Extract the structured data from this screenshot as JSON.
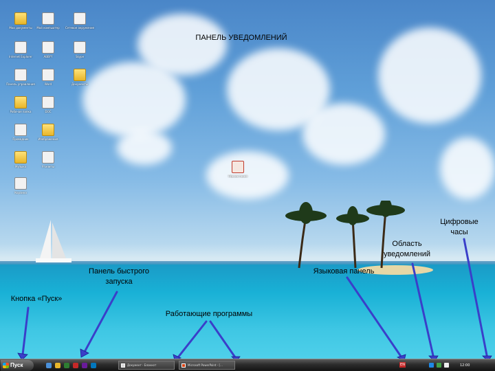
{
  "annotations": {
    "notification_panel": "ПАНЕЛЬ УВЕДОМЛЕНИЙ",
    "digital_clock": "Цифровые часы",
    "tray_area": "Область уведомлений",
    "quick_launch": "Панель быстрого запуска",
    "language_bar": "Языковая панель",
    "start_button": "Кнопка «Пуск»",
    "running_programs": "Работающие программы"
  },
  "taskbar": {
    "start_label": "Пуск",
    "tasks": [
      {
        "label": "Документ - Блокнот"
      },
      {
        "label": "Microsoft PowerPoint - [..."
      }
    ],
    "language": "EN",
    "clock": "12:00"
  },
  "desktop_icons": [
    {
      "label": "Мои документы",
      "icon": "folder"
    },
    {
      "label": "Мой компьютер",
      "icon": "computer"
    },
    {
      "label": "Сетевое окружение",
      "icon": "network"
    },
    {
      "label": "Internet Explorer",
      "icon": "ie"
    },
    {
      "label": "ABBYY",
      "icon": "app"
    },
    {
      "label": "Skype",
      "icon": "app"
    },
    {
      "label": "Панель управления",
      "icon": "control"
    },
    {
      "label": "Word",
      "icon": "doc"
    },
    {
      "label": "Документы",
      "icon": "folder"
    },
    {
      "label": "Рабочая папка",
      "icon": "folder"
    },
    {
      "label": "DOC",
      "icon": "doc"
    },
    {
      "label": "Проводник",
      "icon": "app"
    },
    {
      "label": "Изображения",
      "icon": "folder"
    },
    {
      "label": "Музыка",
      "icon": "folder"
    },
    {
      "label": "Утилиты",
      "icon": "app"
    },
    {
      "label": "Корзина",
      "icon": "app"
    },
    {
      "label": "Презентация",
      "icon": "doc"
    }
  ]
}
